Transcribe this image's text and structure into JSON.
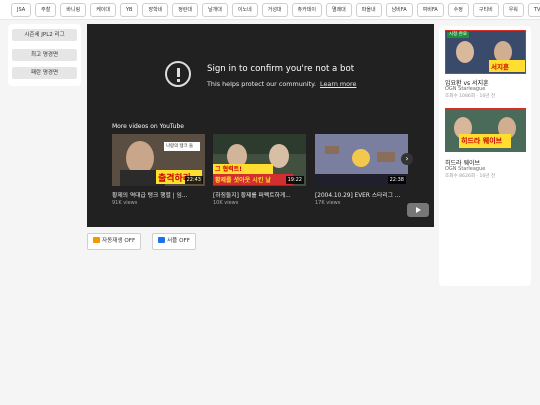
{
  "tags": [
    {
      "label": "JSA",
      "active": false
    },
    {
      "label": "주찰",
      "active": false
    },
    {
      "label": "바니링",
      "active": false
    },
    {
      "label": "케이대",
      "active": false
    },
    {
      "label": "YB",
      "active": false
    },
    {
      "label": "장학네",
      "active": false
    },
    {
      "label": "정란대",
      "active": false
    },
    {
      "label": "날개대",
      "active": false
    },
    {
      "label": "이노네",
      "active": false
    },
    {
      "label": "거성대",
      "active": false
    },
    {
      "label": "츄카데이",
      "active": false
    },
    {
      "label": "멸쾌대",
      "active": false
    },
    {
      "label": "파올내",
      "active": false
    },
    {
      "label": "남비FA",
      "active": false
    },
    {
      "label": "여비FA",
      "active": false
    },
    {
      "label": "수정",
      "active": false
    },
    {
      "label": "구티비",
      "active": false
    },
    {
      "label": "우워",
      "active": false
    },
    {
      "label": "TV영방송",
      "active": false
    },
    {
      "label": "스타영상",
      "active": true
    }
  ],
  "sidebar": {
    "items": [
      {
        "label": "시즌세 JPL2 리그"
      },
      {
        "label": "최고 명경면"
      },
      {
        "label": "패란 명경면"
      }
    ]
  },
  "player": {
    "title": "Sign in to confirm you're not a bot",
    "subtitle": "This helps protect our community.",
    "learn_more": "Learn more",
    "more_videos": "More videos on YouTube",
    "next_icon": "chevron-right-icon",
    "logo_icon": "youtube-logo-icon",
    "videos": [
      {
        "title": "황제의 역대급 탱크 행렬 | 임...",
        "views": "91K views",
        "duration": "22:43",
        "overlay": "출격하라",
        "overlay_top": "나랑의 탱크 들"
      },
      {
        "title": "[하징둘지] 황제를 퍼펙트하게...",
        "views": "10K views",
        "duration": "19:22",
        "overlay": "황제를 셧아웃 시킨 날",
        "overlay_top": "그 협력트!"
      },
      {
        "title": "[2004.10.29] EVER 스타리그 ...",
        "views": "17K views",
        "duration": "22:38",
        "overlay": "",
        "overlay_top": ""
      }
    ]
  },
  "controls": {
    "autoplay": "자동재생 OFF",
    "subtitles": "서플 OFF"
  },
  "right_panel": {
    "cards": [
      {
        "badge": "시청 완료",
        "overlay": "서지훈",
        "title": "임요환 vs 서지훈",
        "channel": "OGN Starleague",
        "meta": "조회수 1086회 · 16년 전"
      },
      {
        "badge": "",
        "overlay": "히드라 웨이브",
        "title": "히드라 웨이브",
        "channel": "OGN Starleague",
        "meta": "조회수 8626회 · 16년 전"
      }
    ]
  },
  "colors": {
    "accent": "#1a73e8",
    "player_bg": "#212121",
    "badge_green": "#1e8e3e",
    "thumb_border": "#d93025"
  }
}
